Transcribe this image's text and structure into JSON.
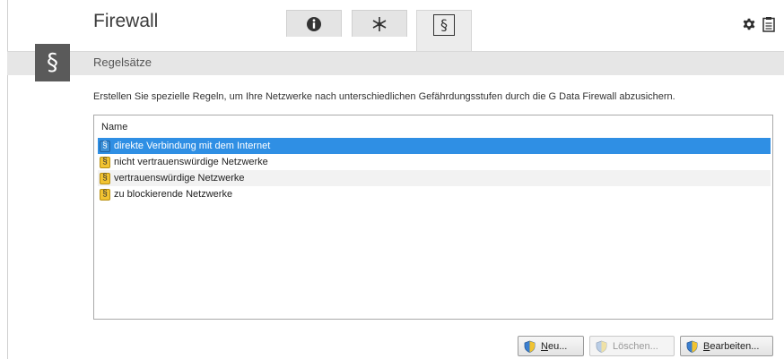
{
  "header": {
    "title": "Firewall",
    "section_symbol": "§"
  },
  "tabs": [
    {
      "name": "info",
      "icon": "info-icon"
    },
    {
      "name": "network",
      "icon": "network-icon"
    },
    {
      "name": "rulesets",
      "icon": "paragraph-icon",
      "label": "§",
      "active": true
    }
  ],
  "top_icons": [
    "gear-icon",
    "clipboard-icon"
  ],
  "section": {
    "label": "Regelsätze",
    "description": "Erstellen Sie spezielle Regeln, um Ihre Netzwerke nach unterschiedlichen Gefährdungsstufen durch die G Data Firewall abzusichern."
  },
  "list": {
    "column_header": "Name",
    "items": [
      {
        "label": "direkte Verbindung mit dem Internet",
        "icon_symbol": "§",
        "icon_color": "#3b8fd6",
        "selected": true
      },
      {
        "label": "nicht vertrauenswürdige Netzwerke",
        "icon_symbol": "§",
        "icon_color": "#f1c331"
      },
      {
        "label": "vertrauenswürdige Netzwerke",
        "icon_symbol": "§",
        "icon_color": "#f1c331"
      },
      {
        "label": "zu blockierende Netzwerke",
        "icon_symbol": "§",
        "icon_color": "#f1c331"
      }
    ]
  },
  "buttons": {
    "new": {
      "mnemonic": "N",
      "rest": "eu..."
    },
    "delete": {
      "label": "Löschen..."
    },
    "edit": {
      "mnemonic": "B",
      "rest": "earbeiten..."
    }
  },
  "colors": {
    "selection": "#2f8fe4",
    "header_bar": "#e6e6e6",
    "section_tile": "#5a5a5a"
  }
}
